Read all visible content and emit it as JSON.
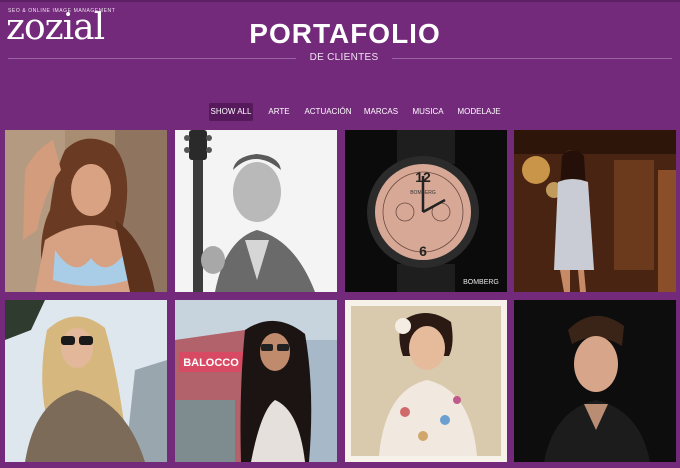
{
  "logo": {
    "word": "ZOZIAL",
    "tagline": "SEO & ONLINE IMAGE MANAGEMENT"
  },
  "header": {
    "title": "PORTAFOLIO",
    "subtitle": "DE CLIENTES"
  },
  "filters": [
    {
      "label": "SHOW ALL",
      "active": true
    },
    {
      "label": "ARTE",
      "active": false
    },
    {
      "label": "ACTUACIÓN",
      "active": false
    },
    {
      "label": "MARCAS",
      "active": false
    },
    {
      "label": "MUSICA",
      "active": false
    },
    {
      "label": "MODELAJE",
      "active": false
    }
  ],
  "portfolio": {
    "watch_brand_dial": "BOMBERG",
    "watch_brand_corner": "BOMBERG",
    "watch_number_12": "12",
    "watch_number_6": "6",
    "billboard_text": "BALOCCO"
  },
  "colors": {
    "background": "#732a7a",
    "filter_active": "#56195b",
    "divider": "#9b62a2"
  }
}
